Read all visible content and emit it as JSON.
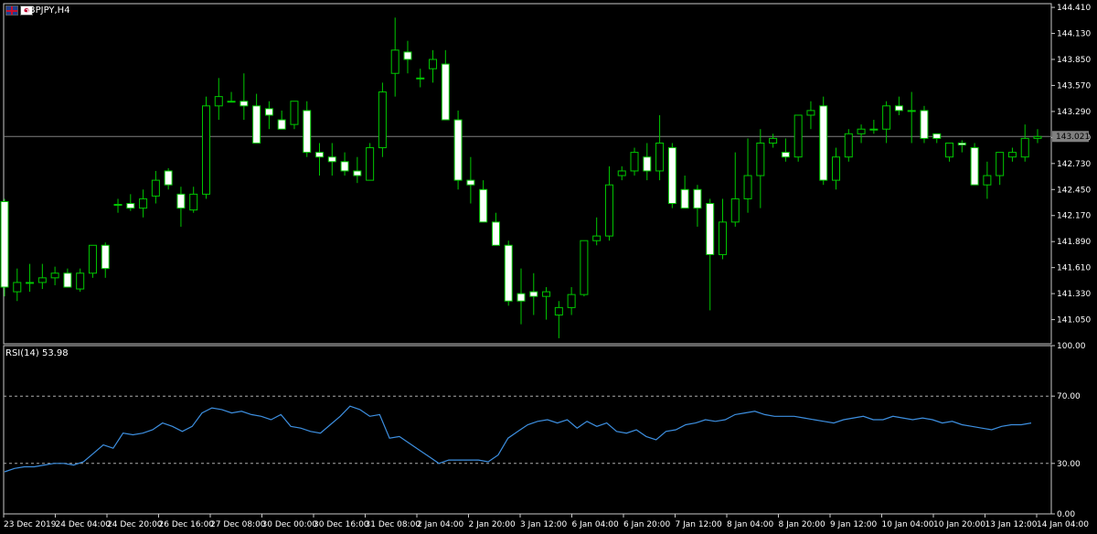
{
  "window": {
    "symbol": "GBPJPY,H4"
  },
  "rsi_panel": {
    "label": "RSI(14) 53.98"
  },
  "colors": {
    "background": "#000000",
    "bull": "#00c800",
    "bear_body": "#ffffff",
    "axis_text": "#ffffff",
    "rsi_line": "#3d8fe0",
    "price_line": "#808080"
  },
  "chart_data": [
    {
      "type": "candlestick",
      "title": "GBPJPY,H4",
      "ylim": [
        140.79,
        144.45
      ],
      "yticks": [
        "144.410",
        "144.130",
        "143.850",
        "143.570",
        "143.290",
        "143.010",
        "142.730",
        "142.450",
        "142.170",
        "141.890",
        "141.610",
        "141.330",
        "141.050"
      ],
      "current_price_label": "143.021",
      "current_price": 143.021,
      "xticks": [
        "23 Dec 2019",
        "24 Dec 04:00",
        "24 Dec 20:00",
        "26 Dec 16:00",
        "27 Dec 08:00",
        "30 Dec 00:00",
        "30 Dec 16:00",
        "31 Dec 08:00",
        "2 Jan 04:00",
        "2 Jan 20:00",
        "3 Jan 12:00",
        "6 Jan 04:00",
        "6 Jan 20:00",
        "7 Jan 12:00",
        "8 Jan 04:00",
        "8 Jan 20:00",
        "9 Jan 12:00",
        "10 Jan 04:00",
        "10 Jan 20:00",
        "13 Jan 12:00",
        "14 Jan 04:00"
      ],
      "ohlc": [
        [
          142.32,
          142.35,
          141.3,
          141.4
        ],
        [
          141.35,
          141.6,
          141.25,
          141.45
        ],
        [
          141.45,
          141.65,
          141.35,
          141.45
        ],
        [
          141.45,
          141.65,
          141.38,
          141.5
        ],
        [
          141.5,
          141.62,
          141.42,
          141.55
        ],
        [
          141.55,
          141.6,
          141.4,
          141.4
        ],
        [
          141.38,
          141.6,
          141.35,
          141.55
        ],
        [
          141.55,
          141.85,
          141.5,
          141.85
        ],
        [
          141.85,
          141.88,
          141.5,
          141.6
        ],
        [
          142.29,
          142.35,
          142.2,
          142.29
        ],
        [
          142.3,
          142.4,
          142.22,
          142.25
        ],
        [
          142.25,
          142.45,
          142.15,
          142.35
        ],
        [
          142.38,
          142.65,
          142.3,
          142.55
        ],
        [
          142.65,
          142.68,
          142.45,
          142.5
        ],
        [
          142.4,
          142.48,
          142.05,
          142.25
        ],
        [
          142.23,
          142.48,
          142.2,
          142.4
        ],
        [
          142.4,
          143.45,
          142.35,
          143.35
        ],
        [
          143.35,
          143.65,
          143.2,
          143.45
        ],
        [
          143.4,
          143.5,
          143.4,
          143.4
        ],
        [
          143.4,
          143.7,
          143.2,
          143.35
        ],
        [
          143.35,
          143.48,
          142.95,
          142.95
        ],
        [
          143.32,
          143.4,
          143.1,
          143.25
        ],
        [
          143.2,
          143.3,
          143.1,
          143.1
        ],
        [
          143.15,
          143.4,
          143.1,
          143.4
        ],
        [
          143.3,
          143.4,
          142.8,
          142.85
        ],
        [
          142.85,
          142.95,
          142.6,
          142.8
        ],
        [
          142.8,
          142.95,
          142.6,
          142.75
        ],
        [
          142.75,
          142.85,
          142.6,
          142.65
        ],
        [
          142.65,
          142.8,
          142.52,
          142.6
        ],
        [
          142.55,
          142.95,
          142.55,
          142.9
        ],
        [
          142.9,
          143.6,
          142.8,
          143.5
        ],
        [
          143.7,
          144.3,
          143.45,
          143.95
        ],
        [
          143.93,
          144.05,
          143.7,
          143.85
        ],
        [
          143.65,
          143.75,
          143.55,
          143.65
        ],
        [
          143.75,
          143.95,
          143.6,
          143.85
        ],
        [
          143.8,
          143.95,
          143.2,
          143.2
        ],
        [
          143.2,
          143.3,
          142.45,
          142.55
        ],
        [
          142.55,
          142.8,
          142.3,
          142.5
        ],
        [
          142.45,
          142.55,
          142.1,
          142.1
        ],
        [
          142.1,
          142.2,
          141.9,
          141.85
        ],
        [
          141.85,
          141.9,
          141.2,
          141.25
        ],
        [
          141.33,
          141.6,
          141.0,
          141.25
        ],
        [
          141.35,
          141.55,
          141.1,
          141.3
        ],
        [
          141.3,
          141.4,
          141.05,
          141.35
        ],
        [
          141.1,
          141.25,
          140.85,
          141.18
        ],
        [
          141.18,
          141.4,
          141.1,
          141.32
        ],
        [
          141.32,
          141.9,
          141.3,
          141.9
        ],
        [
          141.9,
          142.15,
          141.85,
          141.95
        ],
        [
          141.95,
          142.7,
          141.9,
          142.5
        ],
        [
          142.6,
          142.7,
          142.55,
          142.65
        ],
        [
          142.65,
          142.9,
          142.6,
          142.85
        ],
        [
          142.8,
          142.95,
          142.55,
          142.65
        ],
        [
          142.65,
          143.25,
          142.55,
          142.95
        ],
        [
          142.9,
          142.95,
          142.25,
          142.3
        ],
        [
          142.45,
          142.6,
          142.25,
          142.25
        ],
        [
          142.45,
          142.5,
          142.05,
          142.25
        ],
        [
          142.3,
          142.35,
          141.15,
          141.75
        ],
        [
          141.75,
          142.35,
          141.7,
          142.1
        ],
        [
          142.1,
          142.85,
          142.05,
          142.35
        ],
        [
          142.35,
          143.0,
          142.2,
          142.6
        ],
        [
          142.6,
          143.1,
          142.25,
          142.95
        ],
        [
          142.95,
          143.05,
          142.9,
          143.0
        ],
        [
          142.85,
          143.0,
          142.75,
          142.8
        ],
        [
          142.8,
          143.25,
          142.75,
          143.25
        ],
        [
          143.25,
          143.4,
          143.1,
          143.3
        ],
        [
          143.35,
          143.45,
          142.5,
          142.55
        ],
        [
          142.55,
          142.9,
          142.45,
          142.8
        ],
        [
          142.8,
          143.1,
          142.75,
          143.05
        ],
        [
          143.05,
          143.15,
          142.95,
          143.1
        ],
        [
          143.1,
          143.2,
          143.05,
          143.1
        ],
        [
          143.1,
          143.4,
          142.95,
          143.35
        ],
        [
          143.35,
          143.45,
          143.25,
          143.3
        ],
        [
          143.3,
          143.5,
          142.95,
          143.3
        ],
        [
          143.3,
          143.35,
          142.95,
          143.0
        ],
        [
          143.05,
          143.05,
          142.95,
          143.0
        ],
        [
          142.8,
          142.95,
          142.75,
          142.95
        ],
        [
          142.95,
          142.98,
          142.85,
          142.93
        ],
        [
          142.9,
          142.95,
          142.65,
          142.5
        ],
        [
          142.5,
          142.75,
          142.35,
          142.6
        ],
        [
          142.6,
          142.85,
          142.5,
          142.85
        ],
        [
          142.8,
          142.9,
          142.75,
          142.85
        ],
        [
          142.8,
          143.15,
          142.75,
          143.0
        ],
        [
          143.0,
          143.1,
          142.95,
          143.02
        ]
      ]
    },
    {
      "type": "line",
      "title": "RSI(14) 53.98",
      "ylim": [
        0,
        100
      ],
      "yticks": [
        "100.00",
        "70.00",
        "30.00",
        "0.00"
      ],
      "levels": [
        70,
        30
      ],
      "values": [
        25,
        27,
        28,
        28,
        29,
        30,
        30,
        29,
        31,
        36,
        41,
        39,
        48,
        47,
        48,
        50,
        54,
        52,
        49,
        52,
        60,
        63,
        62,
        60,
        61,
        59,
        58,
        56,
        59,
        52,
        51,
        49,
        48,
        53,
        58,
        64,
        62,
        58,
        59,
        45,
        46,
        42,
        38,
        34,
        30,
        32,
        32,
        32,
        32,
        31,
        35,
        45,
        49,
        53,
        55,
        56,
        54,
        56,
        51,
        55,
        52,
        54,
        49,
        48,
        50,
        46,
        44,
        49,
        50,
        53,
        54,
        56,
        55,
        56,
        59,
        60,
        61,
        59,
        58,
        58,
        58,
        57,
        56,
        55,
        54,
        56,
        57,
        58,
        56,
        56,
        58,
        57,
        56,
        57,
        56,
        54,
        55,
        53,
        52,
        51,
        50,
        52,
        53,
        53,
        54
      ]
    }
  ]
}
